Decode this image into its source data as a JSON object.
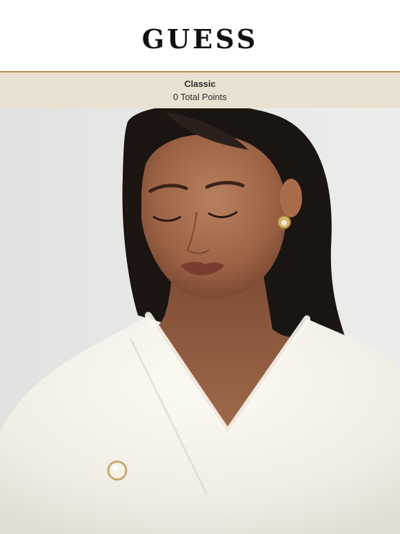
{
  "brand": {
    "logo_text": "GUESS"
  },
  "loyalty": {
    "tier": "Classic",
    "points_text": "0 Total Points"
  },
  "hero": {
    "image_subject": "model-in-white-fuzzy-cardigan"
  },
  "colors": {
    "header_border": "#b38a52",
    "tier_bar_bg": "#e9e2d2",
    "hero_bg": "#e8e8e7"
  }
}
